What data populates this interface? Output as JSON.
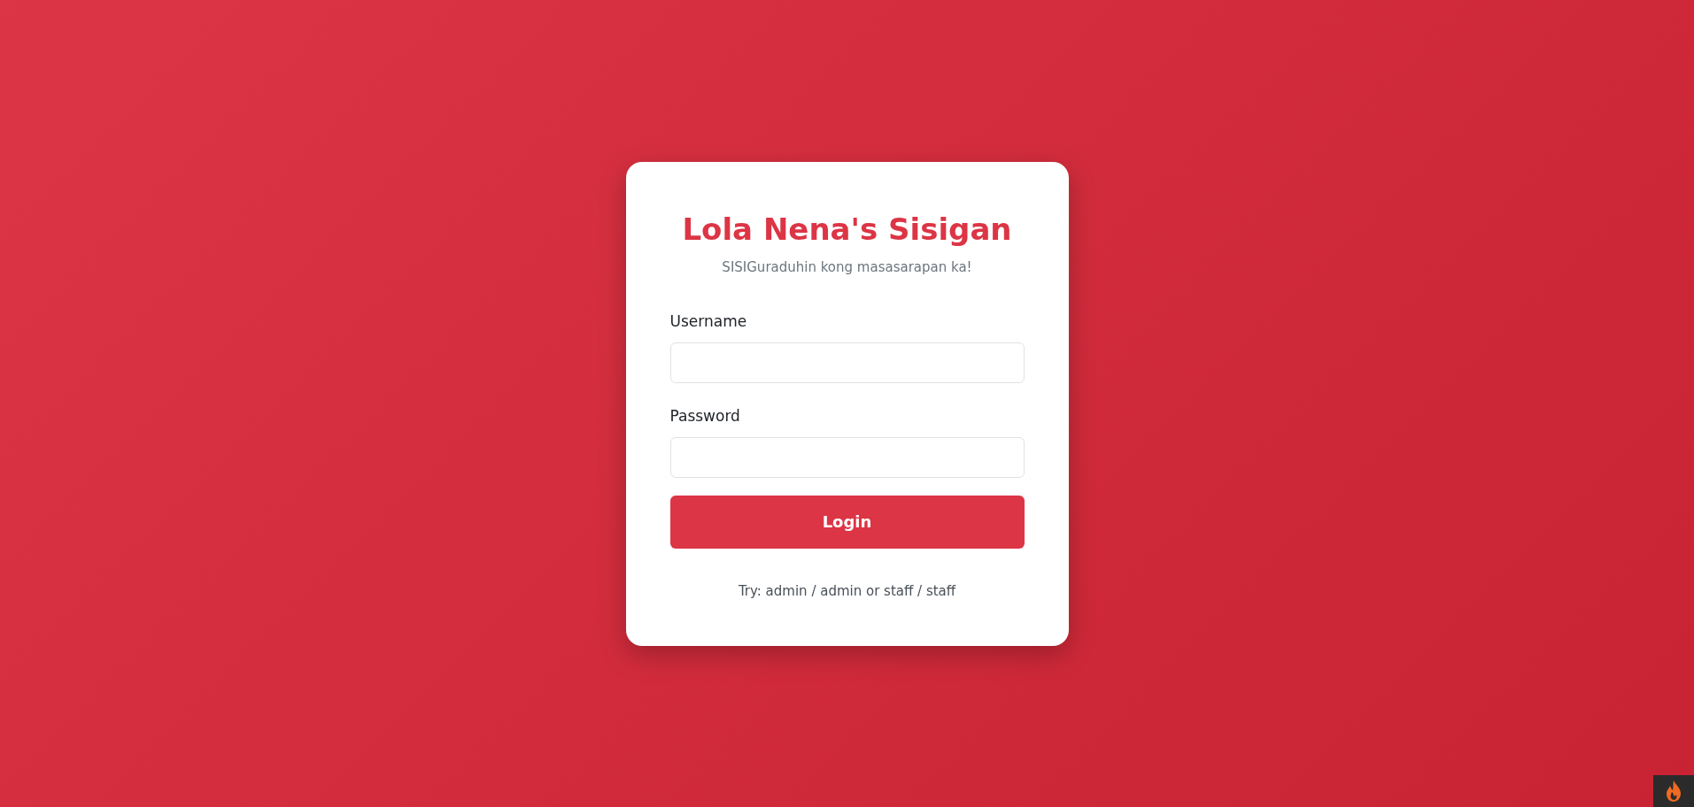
{
  "card": {
    "title": "Lola Nena's Sisigan",
    "subtitle": "SISIGuraduhin kong masasarapan ka!",
    "fields": [
      {
        "label": "Username"
      },
      {
        "label": "Password"
      }
    ],
    "button": "Login",
    "hint": "Try: admin / admin or staff / staff"
  }
}
